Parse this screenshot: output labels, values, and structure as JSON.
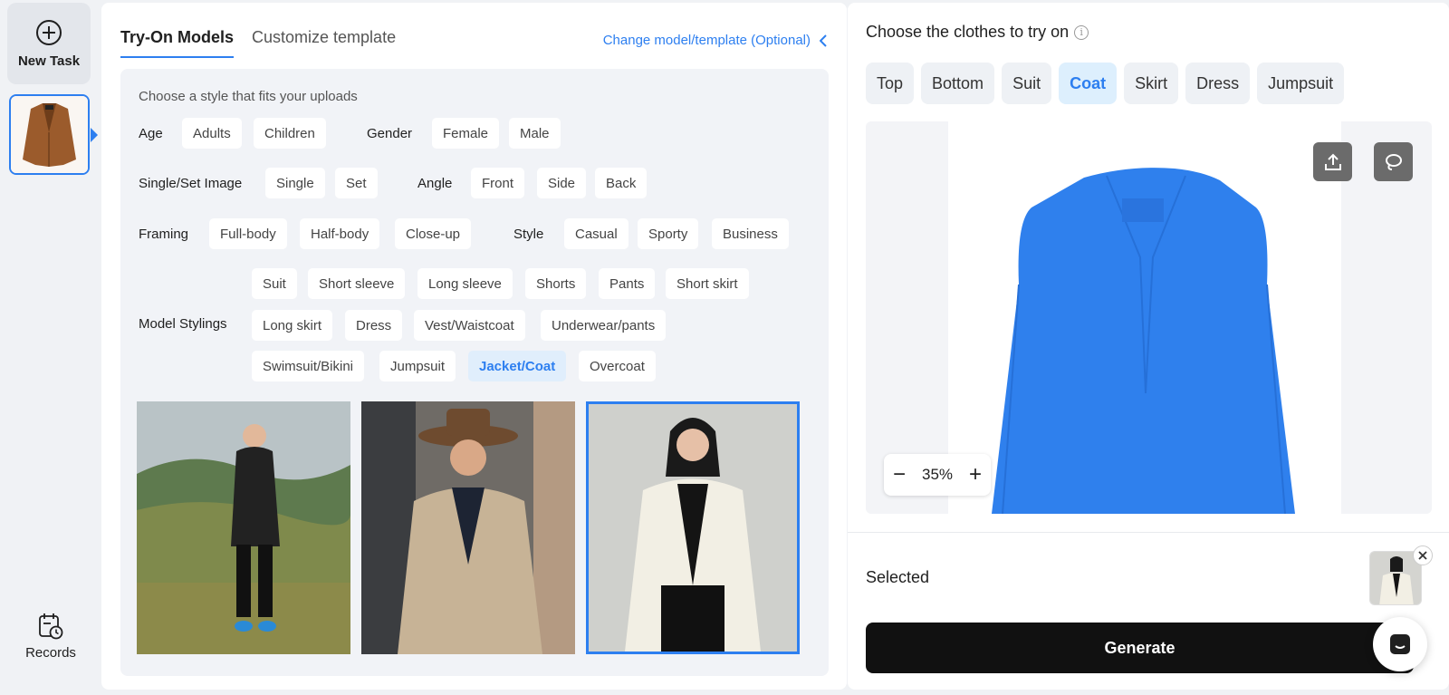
{
  "rail": {
    "new_task_label": "New Task",
    "records_label": "Records"
  },
  "mid": {
    "tabs": [
      {
        "label": "Try-On Models",
        "active": true
      },
      {
        "label": "Customize template",
        "active": false
      }
    ],
    "change_link": "Change model/template (Optional)",
    "hint": "Choose a style that fits your uploads",
    "age": {
      "label": "Age",
      "options": [
        "Adults",
        "Children"
      ]
    },
    "gender": {
      "label": "Gender",
      "options": [
        "Female",
        "Male"
      ]
    },
    "single_set": {
      "label": "Single/Set Image",
      "options": [
        "Single",
        "Set"
      ]
    },
    "angle": {
      "label": "Angle",
      "options": [
        "Front",
        "Side",
        "Back"
      ]
    },
    "framing": {
      "label": "Framing",
      "options": [
        "Full-body",
        "Half-body",
        "Close-up"
      ]
    },
    "style": {
      "label": "Style",
      "options": [
        "Casual",
        "Sporty",
        "Business"
      ]
    },
    "stylings": {
      "label": "Model Stylings",
      "options": [
        "Suit",
        "Short sleeve",
        "Long sleeve",
        "Shorts",
        "Pants",
        "Short skirt",
        "Long skirt",
        "Dress",
        "Vest/Waistcoat",
        "Underwear/pants",
        "Swimsuit/Bikini",
        "Jumpsuit",
        "Jacket/Coat",
        "Overcoat"
      ],
      "selected": "Jacket/Coat"
    }
  },
  "right": {
    "title": "Choose the clothes to try on",
    "info_icon": "info-icon",
    "clothes_tabs": [
      "Top",
      "Bottom",
      "Suit",
      "Coat",
      "Skirt",
      "Dress",
      "Jumpsuit"
    ],
    "selected_tab": "Coat",
    "zoom": "35%",
    "mask_color": "#2f80ed",
    "selected_label": "Selected",
    "generate_label": "Generate"
  },
  "colors": {
    "accent": "#2d7ff0",
    "generate_bg": "#111111"
  }
}
